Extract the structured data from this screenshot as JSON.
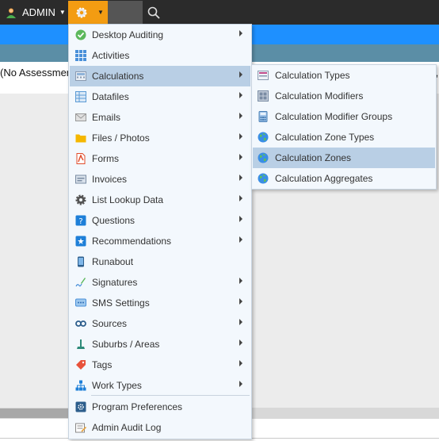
{
  "topbar": {
    "user_label": "ADMIN",
    "user_icon": "user-icon",
    "settings_icon": "gear-icon",
    "search_icon": "search-icon",
    "accent": "#f39c12"
  },
  "page": {
    "assessment_text": "(No Assessmer",
    "trailing_text": "],"
  },
  "menu": {
    "items": [
      {
        "label": "Desktop Auditing",
        "icon": "check-circle-icon",
        "submenu": true
      },
      {
        "label": "Activities",
        "icon": "grid-icon",
        "submenu": false
      },
      {
        "label": "Calculations",
        "icon": "calculator-icon",
        "submenu": true,
        "selected": true
      },
      {
        "label": "Datafiles",
        "icon": "table-icon",
        "submenu": true
      },
      {
        "label": "Emails",
        "icon": "envelope-icon",
        "submenu": true
      },
      {
        "label": "Files / Photos",
        "icon": "folder-icon",
        "submenu": true
      },
      {
        "label": "Forms",
        "icon": "pdf-icon",
        "submenu": true
      },
      {
        "label": "Invoices",
        "icon": "invoice-icon",
        "submenu": true
      },
      {
        "label": "List Lookup Data",
        "icon": "cog-icon",
        "submenu": true
      },
      {
        "label": "Questions",
        "icon": "question-icon",
        "submenu": true
      },
      {
        "label": "Recommendations",
        "icon": "star-icon",
        "submenu": true
      },
      {
        "label": "Runabout",
        "icon": "phone-icon",
        "submenu": false
      },
      {
        "label": "Signatures",
        "icon": "pen-icon",
        "submenu": true
      },
      {
        "label": "SMS Settings",
        "icon": "chat-icon",
        "submenu": true
      },
      {
        "label": "Sources",
        "icon": "link-icon",
        "submenu": true
      },
      {
        "label": "Suburbs / Areas",
        "icon": "pin-icon",
        "submenu": true
      },
      {
        "label": "Tags",
        "icon": "tag-icon",
        "submenu": true
      },
      {
        "label": "Work Types",
        "icon": "hierarchy-icon",
        "submenu": true
      },
      {
        "label": "Program Preferences",
        "icon": "preferences-icon",
        "submenu": false
      },
      {
        "label": "Admin Audit Log",
        "icon": "audit-log-icon",
        "submenu": false
      }
    ]
  },
  "submenu": {
    "items": [
      {
        "label": "Calculation Types",
        "icon": "calc-types-icon"
      },
      {
        "label": "Calculation Modifiers",
        "icon": "calc-modifiers-icon"
      },
      {
        "label": "Calculation Modifier Groups",
        "icon": "calculator-icon"
      },
      {
        "label": "Calculation Zone Types",
        "icon": "globe-icon"
      },
      {
        "label": "Calculation Zones",
        "icon": "globe-icon",
        "selected": true
      },
      {
        "label": "Calculation Aggregates",
        "icon": "globe-icon"
      }
    ]
  }
}
